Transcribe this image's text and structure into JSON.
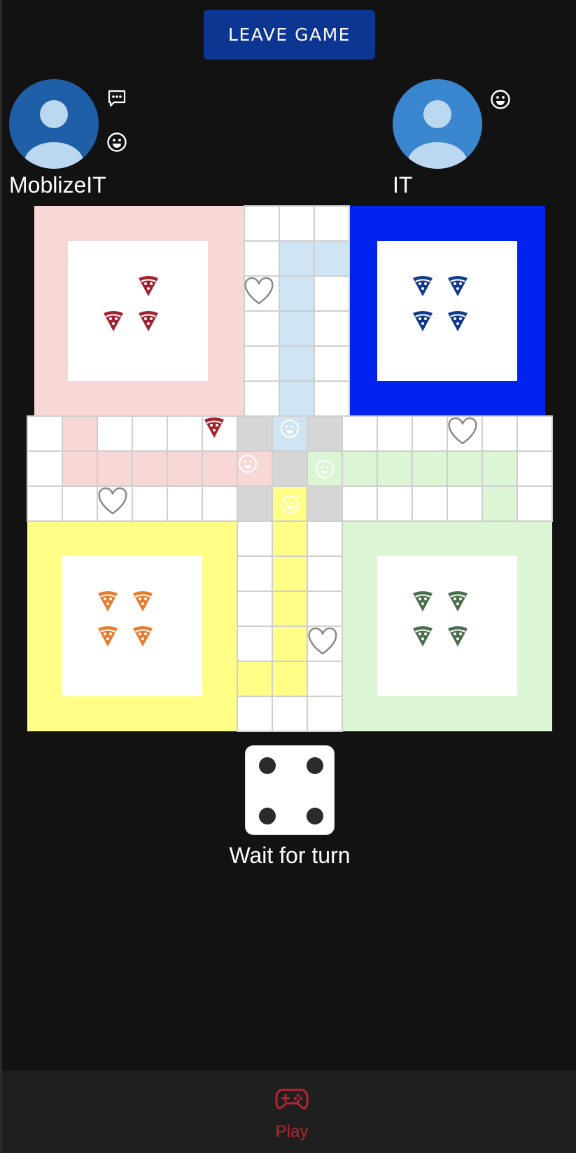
{
  "header": {
    "leave_label": "LEAVE GAME"
  },
  "players": [
    {
      "name": "MoblizeIT",
      "avatar_color": "#1f5fa8"
    },
    {
      "name": "IT",
      "avatar_color": "#3a86cf"
    }
  ],
  "icons": {
    "chat": "chat-bubble-icon",
    "emoji": "smiley-icon",
    "safe": "heart-icon",
    "start": "smiley-icon",
    "piece": "pizza-slice-icon",
    "play": "gamepad-icon"
  },
  "colors": {
    "red_home": "#f8d7d7",
    "red_piece": "#a3222f",
    "blue_home": "#0022ee",
    "blue_track": "#cfe5f3",
    "blue_piece": "#123a8c",
    "yellow_home": "#ffff88",
    "yellow_piece": "#e87b2d",
    "green_home": "#dbf5d5",
    "green_piece": "#4b6e4e",
    "center": "#d6d6d6",
    "accent": "#b3262f",
    "button": "#0d3592"
  },
  "dice": {
    "value": 4
  },
  "status": {
    "text": "Wait for turn"
  },
  "nav": {
    "play_label": "Play"
  }
}
